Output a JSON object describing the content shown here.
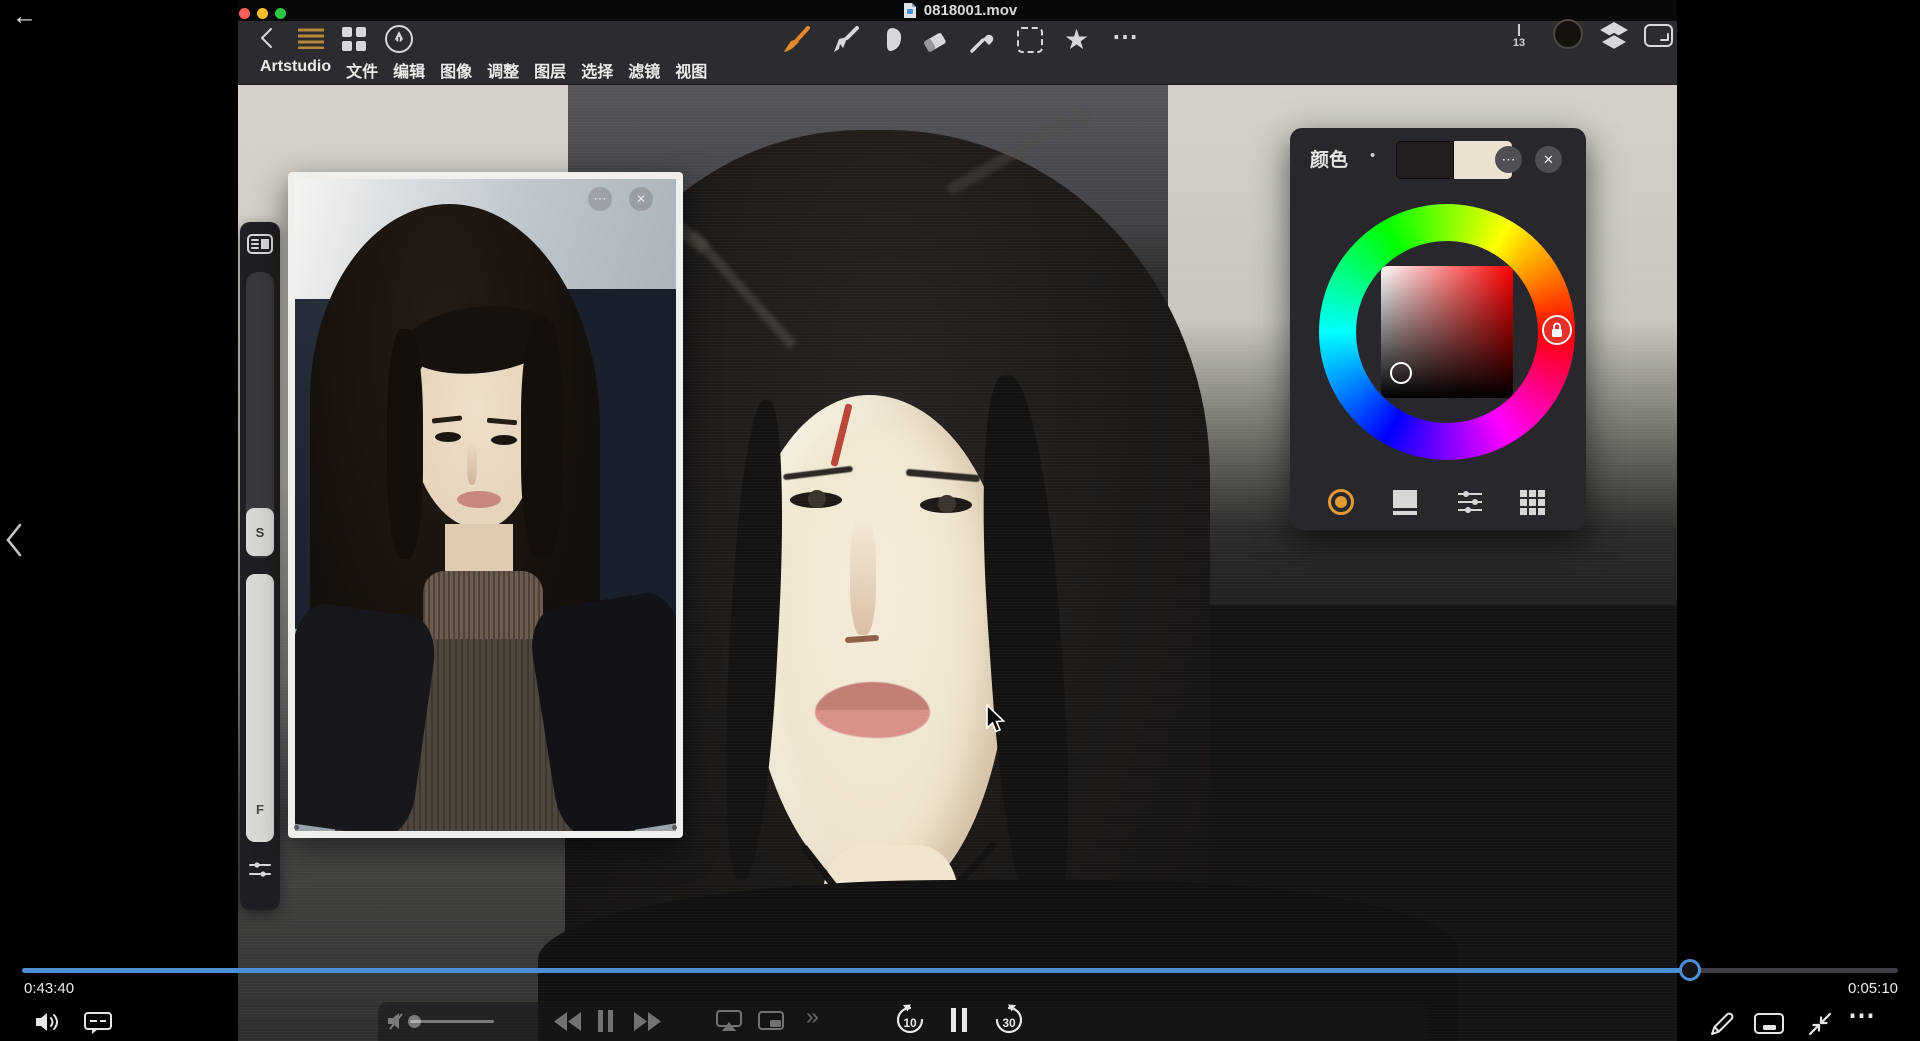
{
  "player": {
    "title": "0818001.mov",
    "elapsed": "0:43:40",
    "remaining": "0:05:10",
    "progress_percent": 88.9,
    "accent_blue": "#4d8fd4",
    "skip_back_label": "10",
    "skip_forward_label": "30"
  },
  "app": {
    "menu": [
      "Artstudio",
      "文件",
      "编辑",
      "图像",
      "调整",
      "图层",
      "选择",
      "滤镜",
      "视图"
    ],
    "brush_size": "13",
    "brush_accent": "#e2892b",
    "hamburger_accent": "#b5893c",
    "sliders": {
      "size": "S",
      "flow": "F"
    },
    "color_panel": {
      "title": "颜色",
      "primary_swatch": "#221f1e",
      "secondary_swatch": "#eae2cf",
      "selected_hue_marker": "#e8302a",
      "mode_active_accent": "#e09a33"
    },
    "traffic_lights": [
      "#ff5f57",
      "#febc2e",
      "#28c840"
    ]
  },
  "icons": {
    "back_arrow": "←",
    "chevron_left": "‹",
    "more_h": "⋯",
    "close": "✕",
    "star": "★",
    "double_chevron": "»",
    "bullet": "•"
  }
}
